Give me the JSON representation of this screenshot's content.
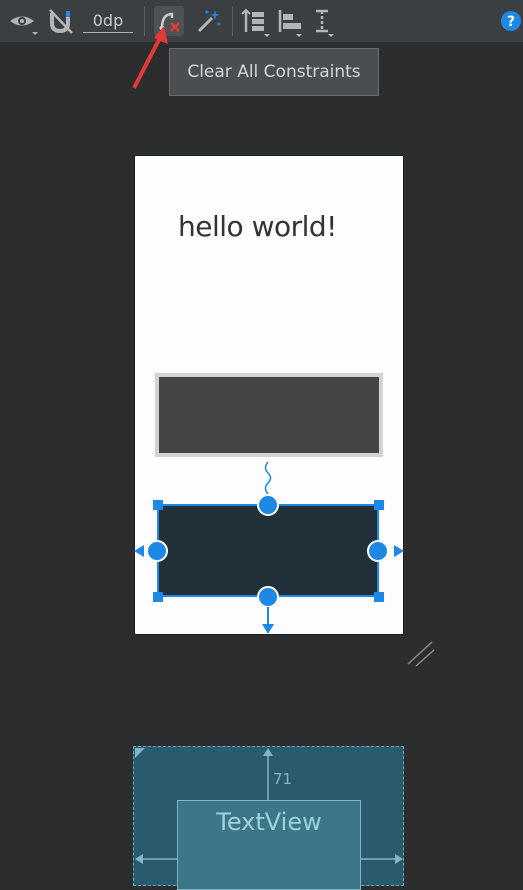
{
  "toolbar": {
    "icons": [
      "eye-icon",
      "magnet-icon",
      "clear-constraints-icon",
      "magic-wand-icon",
      "pack-icon",
      "align-icon",
      "guidelines-icon",
      "help-icon"
    ],
    "default_margin": "0dp",
    "accent_color": "#1e88e5",
    "error_color": "#e53935"
  },
  "tooltip": {
    "text": "Clear All Constraints"
  },
  "design": {
    "text_view_text": "hello world!"
  },
  "blueprint": {
    "text_view_text": "TextView",
    "margin_value": "71"
  }
}
